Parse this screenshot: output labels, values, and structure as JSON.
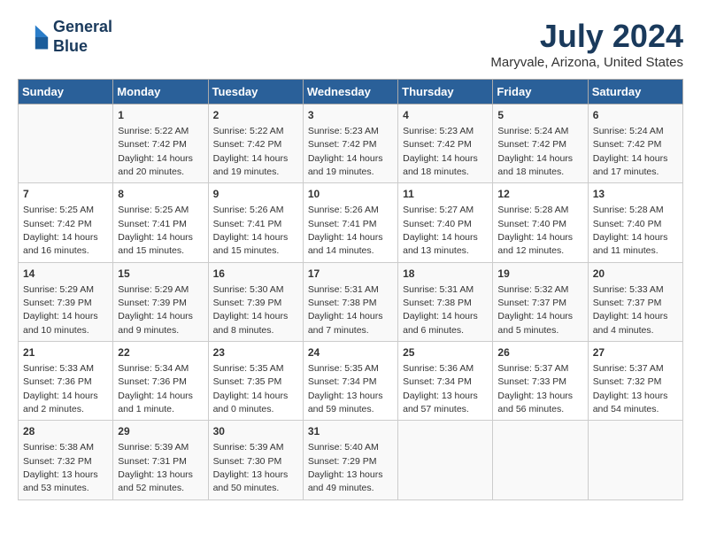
{
  "header": {
    "logo_line1": "General",
    "logo_line2": "Blue",
    "month_year": "July 2024",
    "location": "Maryvale, Arizona, United States"
  },
  "days_of_week": [
    "Sunday",
    "Monday",
    "Tuesday",
    "Wednesday",
    "Thursday",
    "Friday",
    "Saturday"
  ],
  "weeks": [
    [
      {
        "day": "",
        "info": ""
      },
      {
        "day": "1",
        "info": "Sunrise: 5:22 AM\nSunset: 7:42 PM\nDaylight: 14 hours\nand 20 minutes."
      },
      {
        "day": "2",
        "info": "Sunrise: 5:22 AM\nSunset: 7:42 PM\nDaylight: 14 hours\nand 19 minutes."
      },
      {
        "day": "3",
        "info": "Sunrise: 5:23 AM\nSunset: 7:42 PM\nDaylight: 14 hours\nand 19 minutes."
      },
      {
        "day": "4",
        "info": "Sunrise: 5:23 AM\nSunset: 7:42 PM\nDaylight: 14 hours\nand 18 minutes."
      },
      {
        "day": "5",
        "info": "Sunrise: 5:24 AM\nSunset: 7:42 PM\nDaylight: 14 hours\nand 18 minutes."
      },
      {
        "day": "6",
        "info": "Sunrise: 5:24 AM\nSunset: 7:42 PM\nDaylight: 14 hours\nand 17 minutes."
      }
    ],
    [
      {
        "day": "7",
        "info": "Sunrise: 5:25 AM\nSunset: 7:42 PM\nDaylight: 14 hours\nand 16 minutes."
      },
      {
        "day": "8",
        "info": "Sunrise: 5:25 AM\nSunset: 7:41 PM\nDaylight: 14 hours\nand 15 minutes."
      },
      {
        "day": "9",
        "info": "Sunrise: 5:26 AM\nSunset: 7:41 PM\nDaylight: 14 hours\nand 15 minutes."
      },
      {
        "day": "10",
        "info": "Sunrise: 5:26 AM\nSunset: 7:41 PM\nDaylight: 14 hours\nand 14 minutes."
      },
      {
        "day": "11",
        "info": "Sunrise: 5:27 AM\nSunset: 7:40 PM\nDaylight: 14 hours\nand 13 minutes."
      },
      {
        "day": "12",
        "info": "Sunrise: 5:28 AM\nSunset: 7:40 PM\nDaylight: 14 hours\nand 12 minutes."
      },
      {
        "day": "13",
        "info": "Sunrise: 5:28 AM\nSunset: 7:40 PM\nDaylight: 14 hours\nand 11 minutes."
      }
    ],
    [
      {
        "day": "14",
        "info": "Sunrise: 5:29 AM\nSunset: 7:39 PM\nDaylight: 14 hours\nand 10 minutes."
      },
      {
        "day": "15",
        "info": "Sunrise: 5:29 AM\nSunset: 7:39 PM\nDaylight: 14 hours\nand 9 minutes."
      },
      {
        "day": "16",
        "info": "Sunrise: 5:30 AM\nSunset: 7:39 PM\nDaylight: 14 hours\nand 8 minutes."
      },
      {
        "day": "17",
        "info": "Sunrise: 5:31 AM\nSunset: 7:38 PM\nDaylight: 14 hours\nand 7 minutes."
      },
      {
        "day": "18",
        "info": "Sunrise: 5:31 AM\nSunset: 7:38 PM\nDaylight: 14 hours\nand 6 minutes."
      },
      {
        "day": "19",
        "info": "Sunrise: 5:32 AM\nSunset: 7:37 PM\nDaylight: 14 hours\nand 5 minutes."
      },
      {
        "day": "20",
        "info": "Sunrise: 5:33 AM\nSunset: 7:37 PM\nDaylight: 14 hours\nand 4 minutes."
      }
    ],
    [
      {
        "day": "21",
        "info": "Sunrise: 5:33 AM\nSunset: 7:36 PM\nDaylight: 14 hours\nand 2 minutes."
      },
      {
        "day": "22",
        "info": "Sunrise: 5:34 AM\nSunset: 7:36 PM\nDaylight: 14 hours\nand 1 minute."
      },
      {
        "day": "23",
        "info": "Sunrise: 5:35 AM\nSunset: 7:35 PM\nDaylight: 14 hours\nand 0 minutes."
      },
      {
        "day": "24",
        "info": "Sunrise: 5:35 AM\nSunset: 7:34 PM\nDaylight: 13 hours\nand 59 minutes."
      },
      {
        "day": "25",
        "info": "Sunrise: 5:36 AM\nSunset: 7:34 PM\nDaylight: 13 hours\nand 57 minutes."
      },
      {
        "day": "26",
        "info": "Sunrise: 5:37 AM\nSunset: 7:33 PM\nDaylight: 13 hours\nand 56 minutes."
      },
      {
        "day": "27",
        "info": "Sunrise: 5:37 AM\nSunset: 7:32 PM\nDaylight: 13 hours\nand 54 minutes."
      }
    ],
    [
      {
        "day": "28",
        "info": "Sunrise: 5:38 AM\nSunset: 7:32 PM\nDaylight: 13 hours\nand 53 minutes."
      },
      {
        "day": "29",
        "info": "Sunrise: 5:39 AM\nSunset: 7:31 PM\nDaylight: 13 hours\nand 52 minutes."
      },
      {
        "day": "30",
        "info": "Sunrise: 5:39 AM\nSunset: 7:30 PM\nDaylight: 13 hours\nand 50 minutes."
      },
      {
        "day": "31",
        "info": "Sunrise: 5:40 AM\nSunset: 7:29 PM\nDaylight: 13 hours\nand 49 minutes."
      },
      {
        "day": "",
        "info": ""
      },
      {
        "day": "",
        "info": ""
      },
      {
        "day": "",
        "info": ""
      }
    ]
  ]
}
